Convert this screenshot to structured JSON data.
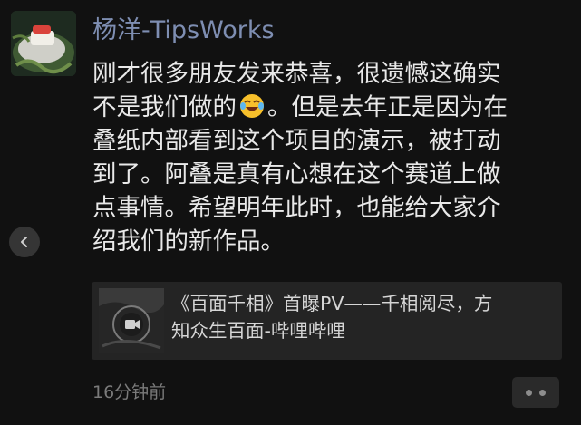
{
  "post": {
    "author": "杨洋-TipsWorks",
    "avatar_icon": "food-plate-avatar",
    "body_lines": [
      {
        "text": "刚才很多朋友发来恭喜，很遗憾这确实"
      },
      {
        "text": "不是我们做的",
        "emoji": "laugh-cry-emoji",
        "after": "。但是去年正是因为在"
      },
      {
        "text": "叠纸内部看到这个项目的演示，被打动"
      },
      {
        "text": "到了。阿叠是真有心想在这个赛道上做"
      },
      {
        "text": "点事情。希望明年此时，也能给大家介"
      },
      {
        "text": "绍我们的新作品。"
      }
    ],
    "link_card": {
      "title_lines": [
        "《百面千相》首曝PV——千相阅尽，方",
        "知众生百面-哔哩哔哩"
      ],
      "thumb_icon": "video-play-icon"
    },
    "time": "16分钟前",
    "more_icon": "more-dots-icon",
    "back_icon": "chevron-left-icon"
  },
  "colors": {
    "background": "#111111",
    "author": "#7e8eb2",
    "text": "#e9e9e9",
    "meta": "#7b7b7b",
    "card": "#242424"
  }
}
